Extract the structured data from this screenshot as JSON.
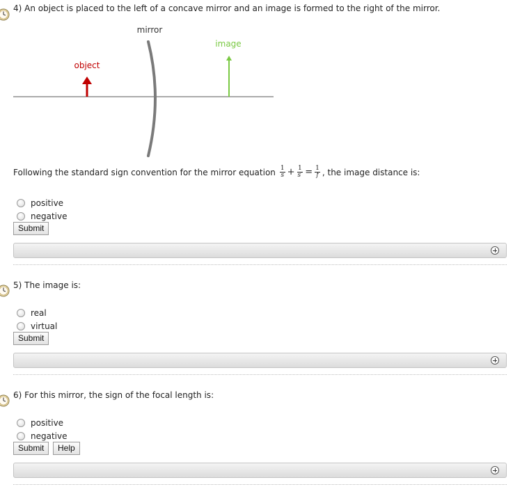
{
  "q4": {
    "text": "4) An object is placed to the left of a concave mirror and an image is formed to the right of the mirror.",
    "diagram": {
      "mirror_label": "mirror",
      "image_label": "image",
      "object_label": "object",
      "object_color": "#c00000",
      "image_color": "#7ac943",
      "mirror_color": "#777777",
      "axis_color": "#555555"
    },
    "prompt_before": "Following the standard sign convention for the mirror equation",
    "prompt_after": ", the image distance is:",
    "eq": {
      "one": "1",
      "s": "s",
      "sp": "s′",
      "f": "f",
      "plus": "+",
      "eq": "="
    },
    "options": [
      "positive",
      "negative"
    ],
    "submit": "Submit"
  },
  "q5": {
    "text": "5) The image is:",
    "options": [
      "real",
      "virtual"
    ],
    "submit": "Submit"
  },
  "q6": {
    "text": "6) For this mirror, the sign of the focal length is:",
    "options": [
      "positive",
      "negative"
    ],
    "submit": "Submit",
    "help": "Help"
  }
}
